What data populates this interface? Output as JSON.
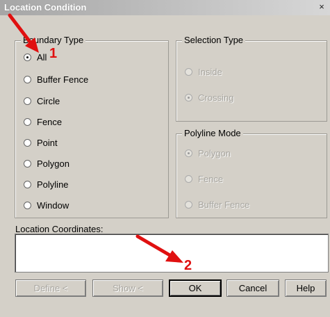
{
  "window": {
    "title": "Location Condition",
    "close_glyph": "×"
  },
  "boundary": {
    "legend": "Boundary Type",
    "options": [
      {
        "label": "All",
        "checked": true
      },
      {
        "label": "Buffer Fence",
        "checked": false
      },
      {
        "label": "Circle",
        "checked": false
      },
      {
        "label": "Fence",
        "checked": false
      },
      {
        "label": "Point",
        "checked": false
      },
      {
        "label": "Polygon",
        "checked": false
      },
      {
        "label": "Polyline",
        "checked": false
      },
      {
        "label": "Window",
        "checked": false
      }
    ]
  },
  "selection": {
    "legend": "Selection Type",
    "options": [
      {
        "label": "Inside",
        "checked": false
      },
      {
        "label": "Crossing",
        "checked": true
      }
    ]
  },
  "polyline": {
    "legend": "Polyline Mode",
    "options": [
      {
        "label": "Polygon",
        "checked": true
      },
      {
        "label": "Fence",
        "checked": false
      },
      {
        "label": "Buffer Fence",
        "checked": false
      }
    ]
  },
  "coordinates": {
    "label": "Location Coordinates:",
    "value": ""
  },
  "buttons": {
    "define": "Define <",
    "show": "Show <",
    "ok": "OK",
    "cancel": "Cancel",
    "help": "Help"
  },
  "annotations": {
    "mark1": "1",
    "mark2": "2",
    "arrow_color": "#e01010"
  }
}
